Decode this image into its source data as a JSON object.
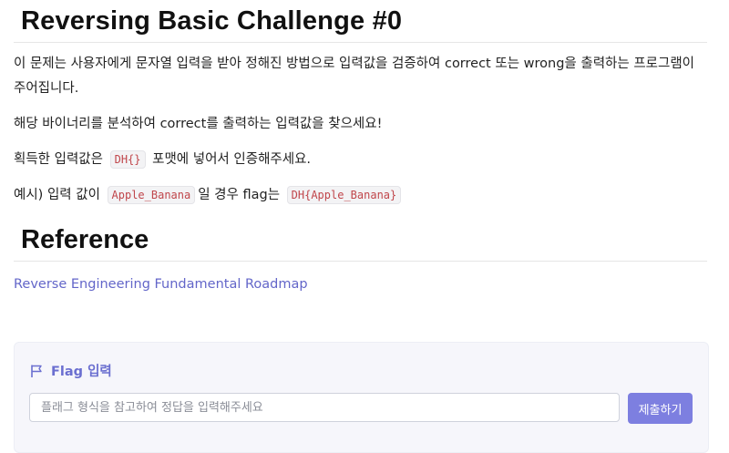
{
  "challenge": {
    "title": "Reversing Basic Challenge #0",
    "description_line1": "이 문제는 사용자에게 문자열 입력을 받아 정해진 방법으로 입력값을 검증하여 correct 또는 wrong을 출력하는 프로그램이 주어집니다.",
    "description_line2": "해당 바이너리를 분석하여 correct를 출력하는 입력값을 찾으세요!",
    "format_prefix": "획득한 입력값은",
    "format_code": "DH{}",
    "format_suffix": "포맷에 넣어서 인증해주세요.",
    "example_prefix": "예시) 입력 값이",
    "example_code1": "Apple_Banana",
    "example_mid": "일 경우 flag는",
    "example_code2": "DH{Apple_Banana}"
  },
  "reference": {
    "heading": "Reference",
    "link_text": "Reverse Engineering Fundamental Roadmap"
  },
  "flag_form": {
    "heading": "Flag 입력",
    "input_placeholder": "플래그 형식을 참고하여 정답을 입력해주세요",
    "input_value": "",
    "submit_label": "제출하기",
    "icon": "flag-icon"
  },
  "colors": {
    "accent": "#7d7fe0",
    "link": "#6366c9",
    "code_text": "#c0464b",
    "panel_bg": "#f6f6fb"
  }
}
